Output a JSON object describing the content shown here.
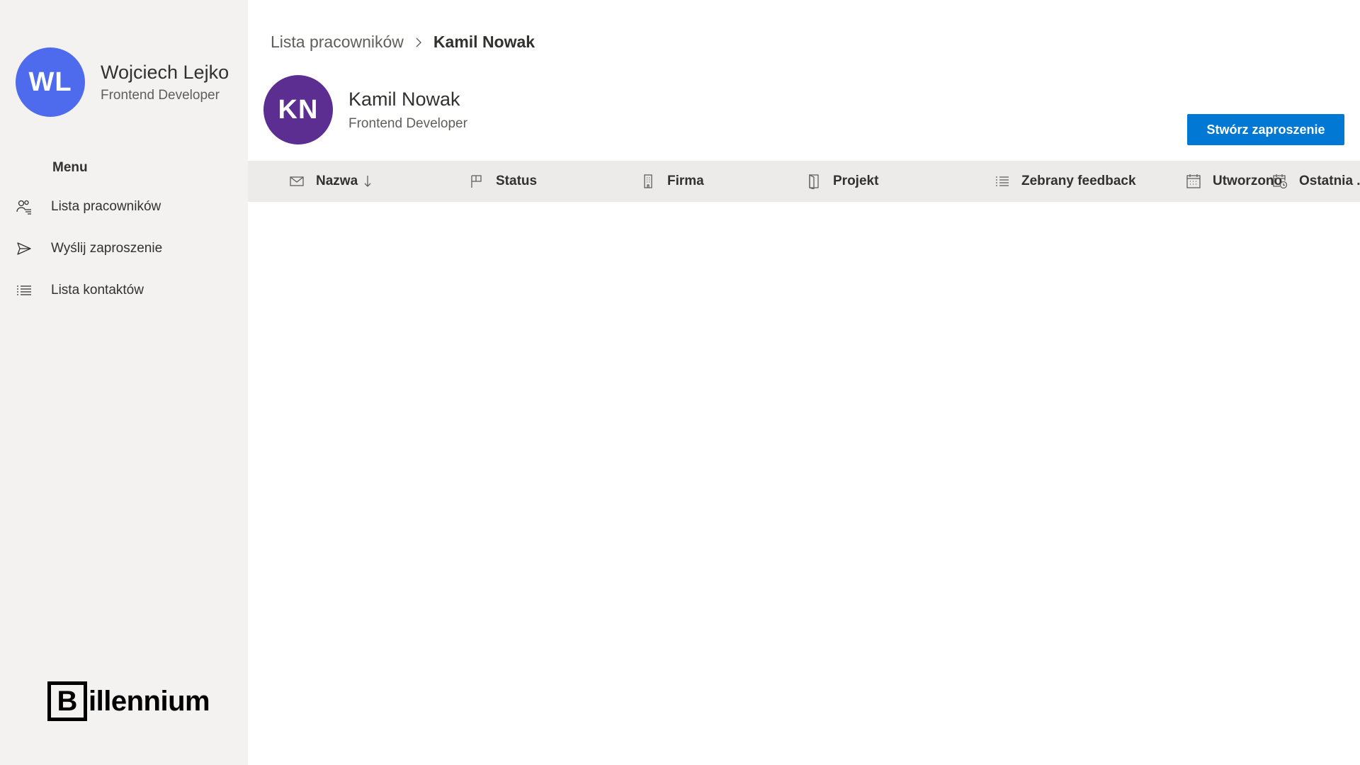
{
  "sidebar": {
    "user": {
      "initials": "WL",
      "name": "Wojciech Lejko",
      "role": "Frontend Developer",
      "avatar_color": "#4f6bed"
    },
    "menu_title": "Menu",
    "items": [
      {
        "label": "Lista pracowników",
        "icon": "people-list-icon"
      },
      {
        "label": "Wyślij zaproszenie",
        "icon": "send-icon"
      },
      {
        "label": "Lista kontaktów",
        "icon": "bulleted-list-icon"
      }
    ],
    "logo": {
      "letter": "B",
      "text": "illennium"
    }
  },
  "breadcrumb": {
    "parent": "Lista pracowników",
    "current": "Kamil Nowak"
  },
  "profile": {
    "initials": "KN",
    "name": "Kamil Nowak",
    "role": "Frontend Developer",
    "avatar_color": "#5c2e91"
  },
  "actions": {
    "create_invitation": "Stwórz zaproszenie",
    "accent_color": "#0078d4"
  },
  "table": {
    "columns": [
      {
        "label": "Nazwa",
        "icon": "mail-icon",
        "sorted": "descending"
      },
      {
        "label": "Status",
        "icon": "flag-icon"
      },
      {
        "label": "Firma",
        "icon": "building-icon"
      },
      {
        "label": "Projekt",
        "icon": "door-icon"
      },
      {
        "label": "Zebrany feedback",
        "icon": "bulleted-list-icon"
      },
      {
        "label": "Utworzono",
        "icon": "calendar-icon"
      },
      {
        "label": "Ostatnia ...",
        "icon": "calendar-clock-icon"
      }
    ],
    "rows": []
  }
}
